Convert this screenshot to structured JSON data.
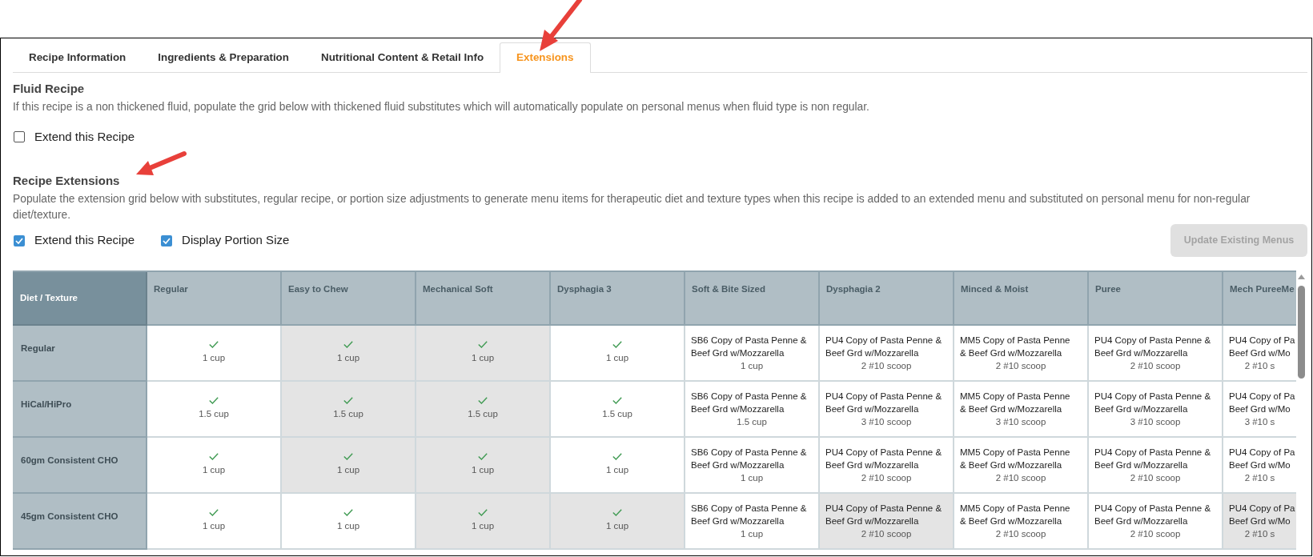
{
  "tabs": [
    {
      "label": "Recipe Information",
      "selected": false
    },
    {
      "label": "Ingredients & Preparation",
      "selected": false
    },
    {
      "label": "Nutritional Content & Retail Info",
      "selected": false
    },
    {
      "label": "Extensions",
      "selected": true
    }
  ],
  "fluid_recipe": {
    "title": "Fluid Recipe",
    "description": "If this recipe is a non thickened fluid, populate the grid below with thickened fluid substitutes which will automatically populate on personal menus when fluid type is non regular.",
    "checkbox": {
      "label": "Extend this Recipe",
      "checked": false
    }
  },
  "recipe_extensions": {
    "title": "Recipe Extensions",
    "description": "Populate the extension grid below with substitutes, regular recipe, or portion size adjustments to generate menu items for therapeutic diet and texture types when this recipe is added to an extended menu and substituted on personal menu for non-regular diet/texture.",
    "checkboxes": [
      {
        "label": "Extend this Recipe",
        "checked": true
      },
      {
        "label": "Display Portion Size",
        "checked": true
      }
    ],
    "update_button": {
      "label": "Update Existing Menus",
      "disabled": true
    }
  },
  "grid": {
    "corner_label": "Diet / Texture",
    "columns": [
      "Regular",
      "Easy to Chew",
      "Mechanical Soft",
      "Dysphagia 3",
      "Soft & Bite Sized",
      "Dysphagia 2",
      "Minced & Moist",
      "Puree",
      "Mech PureeMe"
    ],
    "rows": [
      {
        "label": "Regular",
        "cells": [
          {
            "kind": "check",
            "portion": "1 cup",
            "shaded": false
          },
          {
            "kind": "check",
            "portion": "1 cup",
            "shaded": true
          },
          {
            "kind": "check",
            "portion": "1 cup",
            "shaded": true
          },
          {
            "kind": "check",
            "portion": "1 cup",
            "shaded": false
          },
          {
            "kind": "recipe",
            "lines": [
              "SB6 Copy of Pasta Penne &",
              "Beef Grd w/Mozzarella"
            ],
            "portion": "1 cup",
            "shaded": false
          },
          {
            "kind": "recipe",
            "lines": [
              "PU4 Copy of Pasta Penne &",
              "Beef Grd w/Mozzarella"
            ],
            "portion": "2 #10 scoop",
            "shaded": false
          },
          {
            "kind": "recipe",
            "lines": [
              "MM5 Copy of Pasta Penne",
              "& Beef Grd w/Mozzarella"
            ],
            "portion": "2 #10 scoop",
            "shaded": false
          },
          {
            "kind": "recipe",
            "lines": [
              "PU4 Copy of Pasta Penne &",
              "Beef Grd w/Mozzarella"
            ],
            "portion": "2 #10 scoop",
            "shaded": false
          },
          {
            "kind": "recipe",
            "lines": [
              "PU4 Copy of Pa",
              "Beef Grd w/Mo"
            ],
            "portion": "2 #10 s",
            "shaded": false
          }
        ]
      },
      {
        "label": "HiCal/HiPro",
        "cells": [
          {
            "kind": "check",
            "portion": "1.5 cup",
            "shaded": false
          },
          {
            "kind": "check",
            "portion": "1.5 cup",
            "shaded": true
          },
          {
            "kind": "check",
            "portion": "1.5 cup",
            "shaded": true
          },
          {
            "kind": "check",
            "portion": "1.5 cup",
            "shaded": false
          },
          {
            "kind": "recipe",
            "lines": [
              "SB6 Copy of Pasta Penne &",
              "Beef Grd w/Mozzarella"
            ],
            "portion": "1.5 cup",
            "shaded": false
          },
          {
            "kind": "recipe",
            "lines": [
              "PU4 Copy of Pasta Penne &",
              "Beef Grd w/Mozzarella"
            ],
            "portion": "3 #10 scoop",
            "shaded": false
          },
          {
            "kind": "recipe",
            "lines": [
              "MM5 Copy of Pasta Penne",
              "& Beef Grd w/Mozzarella"
            ],
            "portion": "3 #10 scoop",
            "shaded": false
          },
          {
            "kind": "recipe",
            "lines": [
              "PU4 Copy of Pasta Penne &",
              "Beef Grd w/Mozzarella"
            ],
            "portion": "3 #10 scoop",
            "shaded": false
          },
          {
            "kind": "recipe",
            "lines": [
              "PU4 Copy of Pa",
              "Beef Grd w/Mo"
            ],
            "portion": "3 #10 s",
            "shaded": false
          }
        ]
      },
      {
        "label": "60gm Consistent CHO",
        "cells": [
          {
            "kind": "check",
            "portion": "1 cup",
            "shaded": false
          },
          {
            "kind": "check",
            "portion": "1 cup",
            "shaded": true
          },
          {
            "kind": "check",
            "portion": "1 cup",
            "shaded": true
          },
          {
            "kind": "check",
            "portion": "1 cup",
            "shaded": false
          },
          {
            "kind": "recipe",
            "lines": [
              "SB6 Copy of Pasta Penne &",
              "Beef Grd w/Mozzarella"
            ],
            "portion": "1 cup",
            "shaded": false
          },
          {
            "kind": "recipe",
            "lines": [
              "PU4 Copy of Pasta Penne &",
              "Beef Grd w/Mozzarella"
            ],
            "portion": "2 #10 scoop",
            "shaded": false
          },
          {
            "kind": "recipe",
            "lines": [
              "MM5 Copy of Pasta Penne",
              "& Beef Grd w/Mozzarella"
            ],
            "portion": "2 #10 scoop",
            "shaded": false
          },
          {
            "kind": "recipe",
            "lines": [
              "PU4 Copy of Pasta Penne &",
              "Beef Grd w/Mozzarella"
            ],
            "portion": "2 #10 scoop",
            "shaded": false
          },
          {
            "kind": "recipe",
            "lines": [
              "PU4 Copy of Pa",
              "Beef Grd w/Mo"
            ],
            "portion": "2 #10 s",
            "shaded": false
          }
        ]
      },
      {
        "label": "45gm Consistent CHO",
        "cells": [
          {
            "kind": "check",
            "portion": "1 cup",
            "shaded": false
          },
          {
            "kind": "check",
            "portion": "1 cup",
            "shaded": false
          },
          {
            "kind": "check",
            "portion": "1 cup",
            "shaded": true
          },
          {
            "kind": "check",
            "portion": "1 cup",
            "shaded": true
          },
          {
            "kind": "recipe",
            "lines": [
              "SB6 Copy of Pasta Penne &",
              "Beef Grd w/Mozzarella"
            ],
            "portion": "1 cup",
            "shaded": false
          },
          {
            "kind": "recipe",
            "lines": [
              "PU4 Copy of Pasta Penne &",
              "Beef Grd w/Mozzarella"
            ],
            "portion": "2 #10 scoop",
            "shaded": true
          },
          {
            "kind": "recipe",
            "lines": [
              "MM5 Copy of Pasta Penne",
              "& Beef Grd w/Mozzarella"
            ],
            "portion": "2 #10 scoop",
            "shaded": false
          },
          {
            "kind": "recipe",
            "lines": [
              "PU4 Copy of Pasta Penne &",
              "Beef Grd w/Mozzarella"
            ],
            "portion": "2 #10 scoop",
            "shaded": false
          },
          {
            "kind": "recipe",
            "lines": [
              "PU4 Copy of Pa",
              "Beef Grd w/Mo"
            ],
            "portion": "2 #10 s",
            "shaded": true
          }
        ]
      }
    ]
  }
}
